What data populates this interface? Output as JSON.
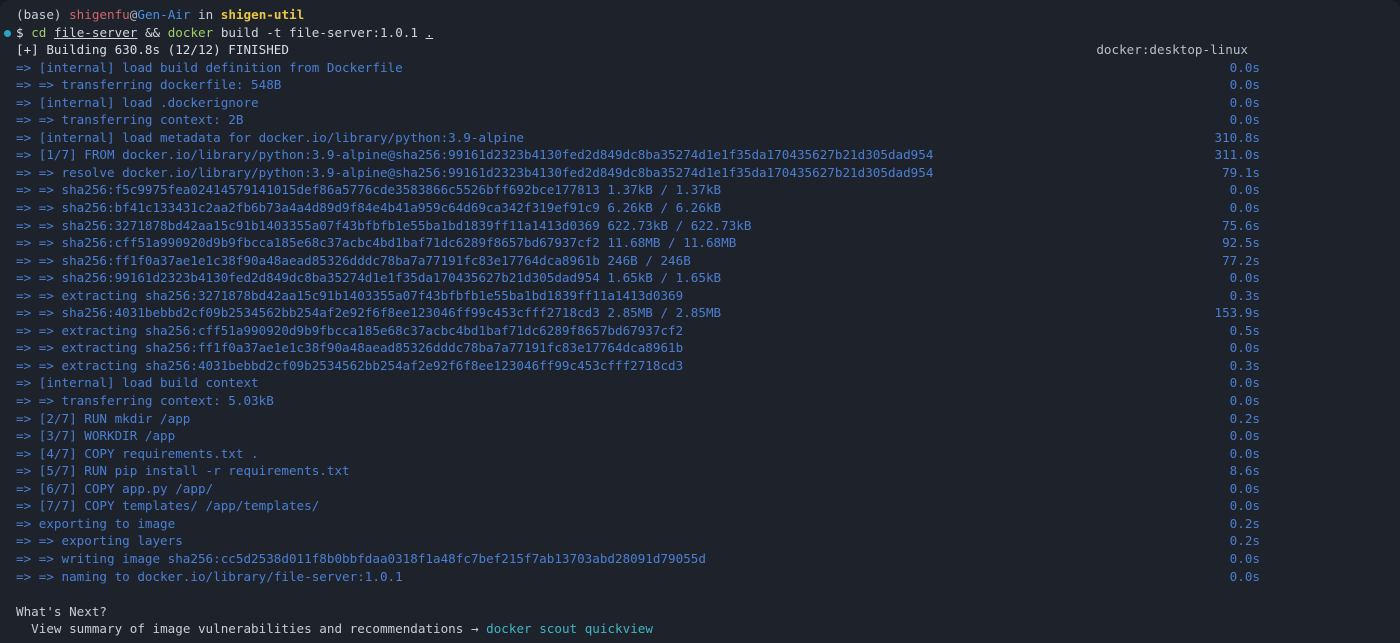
{
  "window": {
    "app": "terminal",
    "background_color": "#1e222a",
    "foreground_color": "#c5cdd6",
    "accent_blue": "#4a7fd4",
    "accent_cyan": "#3fb6c8",
    "prompt_bullet_color": "#2ba3c4"
  },
  "prompt": {
    "env": "(base)",
    "user": "shigenfu",
    "at": "@",
    "host": "Gen-Air",
    "in_word": "in",
    "directory": "shigen-util",
    "symbol": "$",
    "cmd_cd": "cd",
    "cmd_cd_arg": "file-server",
    "cmd_and": "&&",
    "cmd_docker": "docker",
    "cmd_docker_args": "build -t file-server:1.0.1",
    "cmd_context": "."
  },
  "build_header": {
    "text": "[+] Building 630.8s (12/12) FINISHED",
    "driver": "docker:desktop-linux"
  },
  "steps": [
    {
      "text": "=> [internal] load build definition from Dockerfile",
      "time": "0.0s"
    },
    {
      "text": "=> => transferring dockerfile: 548B",
      "time": "0.0s"
    },
    {
      "text": "=> [internal] load .dockerignore",
      "time": "0.0s"
    },
    {
      "text": "=> => transferring context: 2B",
      "time": "0.0s"
    },
    {
      "text": "=> [internal] load metadata for docker.io/library/python:3.9-alpine",
      "time": "310.8s"
    },
    {
      "text": "=> [1/7] FROM docker.io/library/python:3.9-alpine@sha256:99161d2323b4130fed2d849dc8ba35274d1e1f35da170435627b21d305dad954",
      "time": "311.0s"
    },
    {
      "text": "=> => resolve docker.io/library/python:3.9-alpine@sha256:99161d2323b4130fed2d849dc8ba35274d1e1f35da170435627b21d305dad954",
      "time": "79.1s"
    },
    {
      "text": "=> => sha256:f5c9975fea02414579141015def86a5776cde3583866c5526bff692bce177813 1.37kB / 1.37kB",
      "time": "0.0s"
    },
    {
      "text": "=> => sha256:bf41c133431c2aa2fb6b73a4a4d89d9f84e4b41a959c64d69ca342f319ef91c9 6.26kB / 6.26kB",
      "time": "0.0s"
    },
    {
      "text": "=> => sha256:3271878bd42aa15c91b1403355a07f43bfbfb1e55ba1bd1839ff11a1413d0369 622.73kB / 622.73kB",
      "time": "75.6s"
    },
    {
      "text": "=> => sha256:cff51a990920d9b9fbcca185e68c37acbc4bd1baf71dc6289f8657bd67937cf2 11.68MB / 11.68MB",
      "time": "92.5s"
    },
    {
      "text": "=> => sha256:ff1f0a37ae1e1c38f90a48aead85326dddc78ba7a77191fc83e17764dca8961b 246B / 246B",
      "time": "77.2s"
    },
    {
      "text": "=> => sha256:99161d2323b4130fed2d849dc8ba35274d1e1f35da170435627b21d305dad954 1.65kB / 1.65kB",
      "time": "0.0s"
    },
    {
      "text": "=> => extracting sha256:3271878bd42aa15c91b1403355a07f43bfbfb1e55ba1bd1839ff11a1413d0369",
      "time": "0.3s"
    },
    {
      "text": "=> => sha256:4031bebbd2cf09b2534562bb254af2e92f6f8ee123046ff99c453cfff2718cd3 2.85MB / 2.85MB",
      "time": "153.9s"
    },
    {
      "text": "=> => extracting sha256:cff51a990920d9b9fbcca185e68c37acbc4bd1baf71dc6289f8657bd67937cf2",
      "time": "0.5s"
    },
    {
      "text": "=> => extracting sha256:ff1f0a37ae1e1c38f90a48aead85326dddc78ba7a77191fc83e17764dca8961b",
      "time": "0.0s"
    },
    {
      "text": "=> => extracting sha256:4031bebbd2cf09b2534562bb254af2e92f6f8ee123046ff99c453cfff2718cd3",
      "time": "0.3s"
    },
    {
      "text": "=> [internal] load build context",
      "time": "0.0s"
    },
    {
      "text": "=> => transferring context: 5.03kB",
      "time": "0.0s"
    },
    {
      "text": "=> [2/7] RUN mkdir /app",
      "time": "0.2s"
    },
    {
      "text": "=> [3/7] WORKDIR /app",
      "time": "0.0s"
    },
    {
      "text": "=> [4/7] COPY requirements.txt .",
      "time": "0.0s"
    },
    {
      "text": "=> [5/7] RUN pip install -r requirements.txt",
      "time": "8.6s"
    },
    {
      "text": "=> [6/7] COPY app.py /app/",
      "time": "0.0s"
    },
    {
      "text": "=> [7/7] COPY templates/ /app/templates/",
      "time": "0.0s"
    },
    {
      "text": "=> exporting to image",
      "time": "0.2s"
    },
    {
      "text": "=> => exporting layers",
      "time": "0.2s"
    },
    {
      "text": "=> => writing image sha256:cc5d2538d011f8b0bbfdaa0318f1a48fc7bef215f7ab13703abd28091d79055d",
      "time": "0.0s"
    },
    {
      "text": "=> => naming to docker.io/library/file-server:1.0.1",
      "time": "0.0s"
    }
  ],
  "whats_next": {
    "title": "What's Next?",
    "suggestion": "View summary of image vulnerabilities and recommendations",
    "arrow": "→",
    "command": "docker scout quickview"
  }
}
